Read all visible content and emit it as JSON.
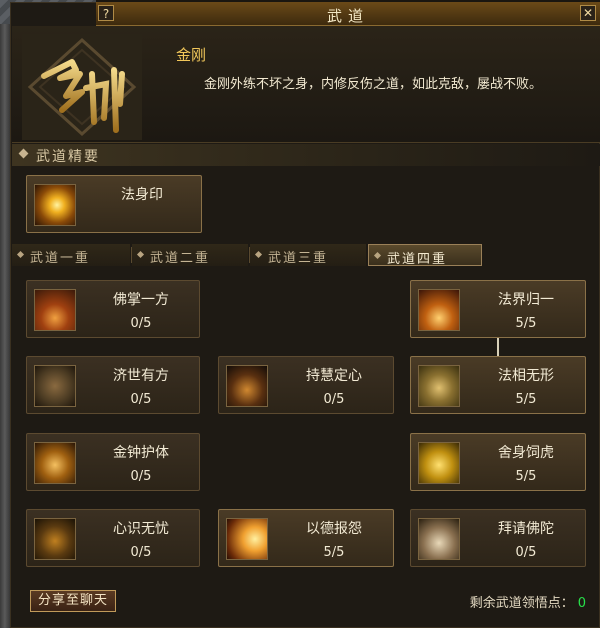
{
  "window": {
    "title": "武道",
    "help_label": "?",
    "close_label": "✕"
  },
  "school": {
    "name": "金刚",
    "description": "金刚外练不坏之身，内修反伤之道，如此克敌，屡战不败。",
    "emblem_text": "金刚"
  },
  "core_section": {
    "title": "武道精要"
  },
  "core_skill": {
    "name": "法身印",
    "icon": "golden-aura-icon"
  },
  "tabs": [
    {
      "label": "武道一重",
      "selected": false
    },
    {
      "label": "武道二重",
      "selected": false
    },
    {
      "label": "武道三重",
      "selected": false
    },
    {
      "label": "武道四重",
      "selected": true
    }
  ],
  "skills": [
    {
      "name": "佛掌一方",
      "level": "0/5",
      "icon": "buddha-palm-icon",
      "active": false
    },
    {
      "name": "法界归一",
      "level": "5/5",
      "icon": "dharma-realm-icon",
      "active": true
    },
    {
      "name": "济世有方",
      "level": "0/5",
      "icon": "swastika-icon",
      "active": false
    },
    {
      "name": "持慧定心",
      "level": "0/5",
      "icon": "meditation-figure-icon",
      "active": false
    },
    {
      "name": "法相无形",
      "level": "5/5",
      "icon": "stone-hand-icon",
      "active": true
    },
    {
      "name": "金钟护体",
      "level": "0/5",
      "icon": "golden-bell-icon",
      "active": false
    },
    {
      "name": "舍身饲虎",
      "level": "5/5",
      "icon": "golden-figure-icon",
      "active": true
    },
    {
      "name": "心识无忧",
      "level": "0/5",
      "icon": "kick-figure-icon",
      "active": false
    },
    {
      "name": "以德报怨",
      "level": "5/5",
      "icon": "light-burst-icon",
      "active": true
    },
    {
      "name": "拜请佛陀",
      "level": "0/5",
      "icon": "reclining-buddha-icon",
      "active": false
    }
  ],
  "footer": {
    "share_label": "分享至聊天",
    "points_label": "剩余武道领悟点：",
    "points_value": "0"
  },
  "colors": {
    "accent_gold": "#f1c75a",
    "points_green": "#27e04a"
  }
}
